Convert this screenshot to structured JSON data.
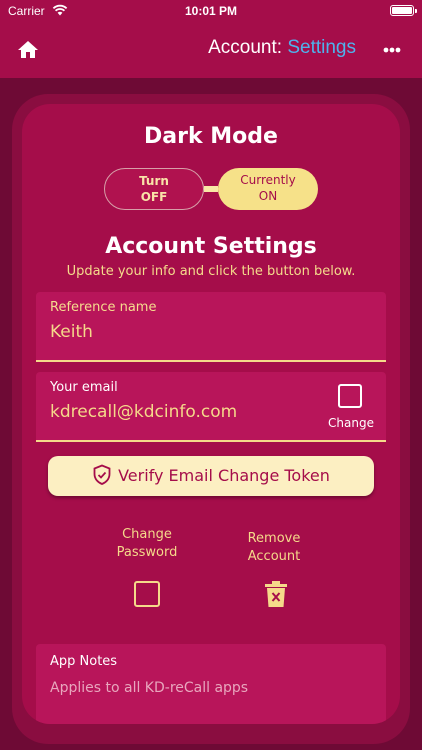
{
  "status_bar": {
    "carrier": "Carrier",
    "time": "10:01 PM"
  },
  "nav": {
    "title_prefix": "Account:",
    "title_accent": "Settings",
    "accent_color": "#4fb2ec"
  },
  "dark_mode": {
    "title": "Dark Mode",
    "off_line1": "Turn",
    "off_line2": "OFF",
    "on_line1": "Currently",
    "on_line2": "ON"
  },
  "account_settings": {
    "title": "Account Settings",
    "subtitle": "Update your info and click the button below.",
    "reference_name": {
      "label": "Reference name",
      "value": "Keith"
    },
    "email": {
      "label": "Your email",
      "value": "kdrecall@kdcinfo.com",
      "change_label": "Change"
    },
    "verify_button": "Verify Email Change Token",
    "change_password": {
      "line1": "Change",
      "line2": "Password"
    },
    "remove_account": {
      "line1": "Remove",
      "line2": "Account"
    }
  },
  "app_notes": {
    "label": "App Notes",
    "value": "Applies to all KD-reCall apps"
  },
  "colors": {
    "primary": "#a50d4a",
    "background": "#6e0a35",
    "accent_yellow": "#f5d98a",
    "button_bg": "#fcefc2"
  },
  "icons": {
    "home": "home-icon",
    "more": "more-horizontal-icon",
    "shield": "shield-check-icon",
    "trash": "trash-icon"
  }
}
